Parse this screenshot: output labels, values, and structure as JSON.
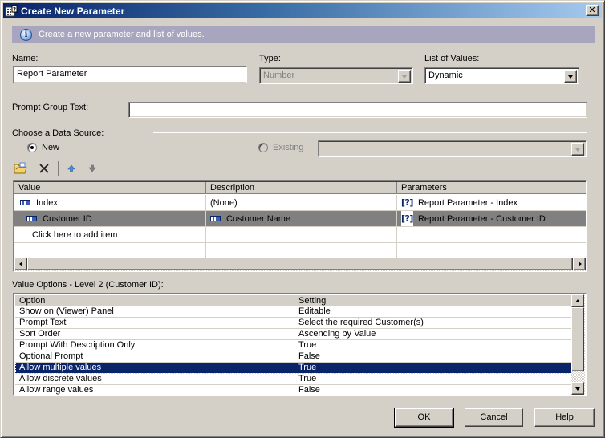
{
  "window": {
    "title": "Create New Parameter",
    "close_glyph": "✕"
  },
  "info": {
    "icon": "info-icon",
    "glyph": "i",
    "text": "Create a new parameter and list of values."
  },
  "form": {
    "name_label": "Name:",
    "name_value": "Report Parameter",
    "type_label": "Type:",
    "type_value": "Number",
    "lov_label": "List of Values:",
    "lov_value": "Dynamic",
    "prompt_group_label": "Prompt Group Text:",
    "prompt_group_value": "",
    "data_source_label": "Choose a Data Source:",
    "radio_new_label": "New",
    "radio_existing_label": "Existing",
    "existing_value": "",
    "selected_source": "New"
  },
  "toolbar": {
    "items": [
      {
        "name": "open-folder-icon",
        "tooltip": ""
      },
      {
        "name": "delete-icon",
        "glyph": "✕"
      },
      {
        "name": "move-up-icon"
      },
      {
        "name": "move-down-icon"
      }
    ]
  },
  "values_grid": {
    "columns": [
      "Value",
      "Description",
      "Parameters"
    ],
    "rows": [
      {
        "value": "Index",
        "value_icon": "field-icon",
        "description": "(None)",
        "description_icon": "",
        "parameter": "Report Parameter - Index",
        "parameter_icon": "[?]",
        "selected": false
      },
      {
        "value": "Customer ID",
        "value_icon": "field-icon",
        "description": "Customer Name",
        "description_icon": "field-icon",
        "parameter": "Report Parameter - Customer ID",
        "parameter_icon": "[?]",
        "selected": true
      },
      {
        "value": "Click here to add item",
        "description": "",
        "parameter": "",
        "selected": false
      }
    ]
  },
  "value_options": {
    "label": "Value Options - Level 2 (Customer ID):",
    "columns": [
      "Option",
      "Setting"
    ],
    "rows": [
      {
        "option": "Show on (Viewer) Panel",
        "setting": "Editable"
      },
      {
        "option": "Prompt Text",
        "setting": "Select the required Customer(s)"
      },
      {
        "option": "Sort Order",
        "setting": "Ascending by Value"
      },
      {
        "option": "Prompt With Description Only",
        "setting": "True"
      },
      {
        "option": "Optional Prompt",
        "setting": "False"
      },
      {
        "option": "Allow multiple values",
        "setting": "True",
        "selected": true
      },
      {
        "option": "Allow discrete values",
        "setting": "True"
      },
      {
        "option": "Allow range values",
        "setting": "False"
      }
    ]
  },
  "buttons": {
    "ok": "OK",
    "cancel": "Cancel",
    "help": "Help"
  },
  "colors": {
    "titlebar_start": "#0a246a",
    "titlebar_end": "#a6caf0",
    "infobar_bg": "#a7a6be",
    "selection_bg": "#0a246a",
    "grid_selected_bg": "#808080",
    "dialog_bg": "#d4d0c8"
  }
}
